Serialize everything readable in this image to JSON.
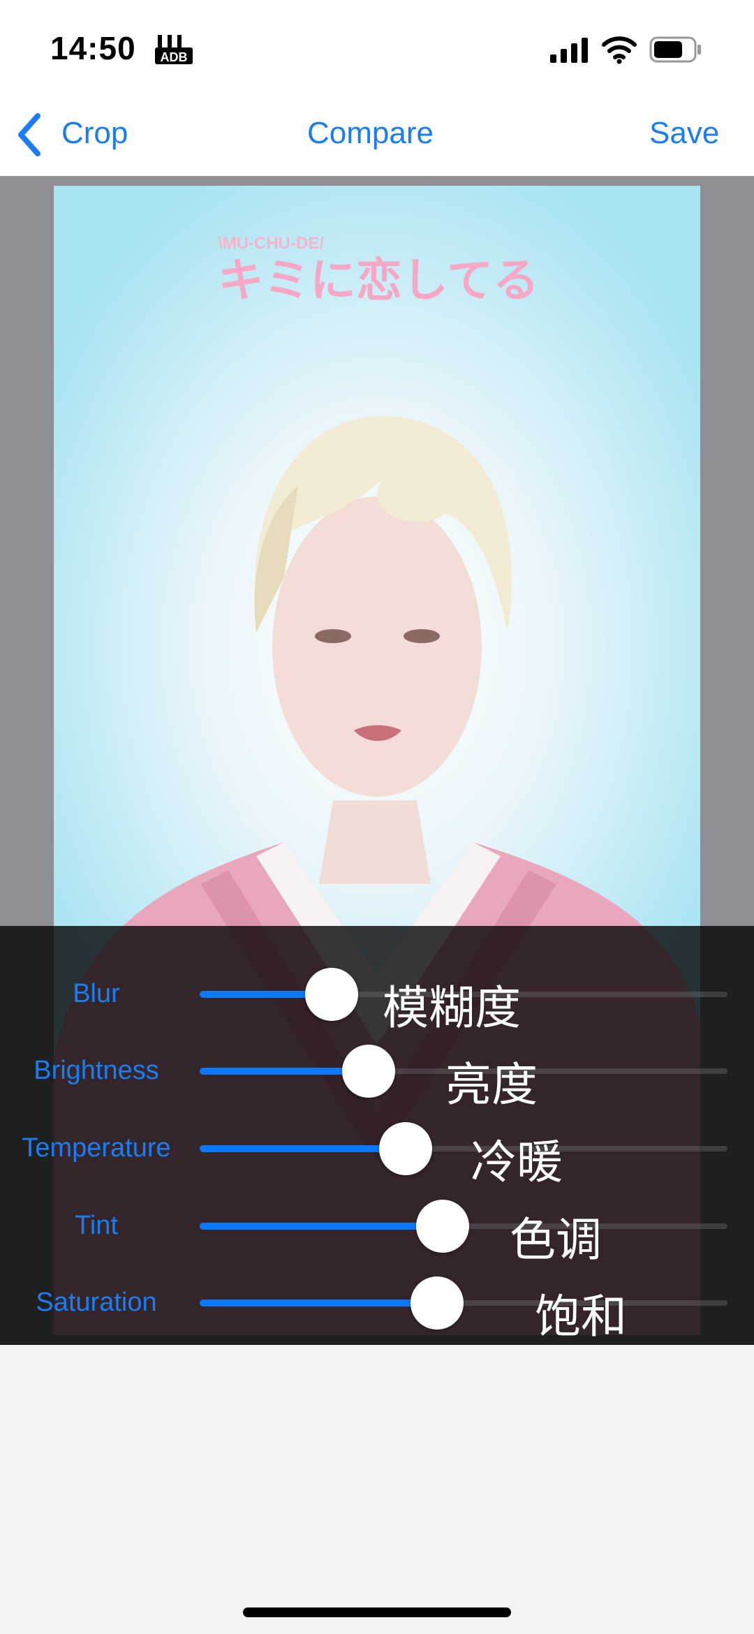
{
  "status_bar": {
    "time": "14:50",
    "time_icon": "wallet-adb-icon",
    "signal_icon": "cellular-signal-icon",
    "wifi_icon": "wifi-icon",
    "battery_icon": "battery-icon",
    "battery_level": 0.7
  },
  "nav": {
    "back_icon": "chevron-left-icon",
    "back_label": "Crop",
    "compare_label": "Compare",
    "save_label": "Save",
    "accent_color": "#1a7ef2"
  },
  "photo": {
    "logo_small": "\\MU-CHU-DE/",
    "logo_main": "キミに恋してる"
  },
  "adjustments": [
    {
      "label": "Blur",
      "note": "模糊度",
      "value": 0.25
    },
    {
      "label": "Brightness",
      "note": "亮度",
      "value": 0.32
    },
    {
      "label": "Temperature",
      "note": "冷暖",
      "value": 0.39
    },
    {
      "label": "Tint",
      "note": "色调",
      "value": 0.46
    },
    {
      "label": "Saturation",
      "note": "饱和",
      "value": 0.45
    }
  ],
  "colors": {
    "slider_fill": "#0a78ff",
    "label_color": "#1a7ef2"
  }
}
